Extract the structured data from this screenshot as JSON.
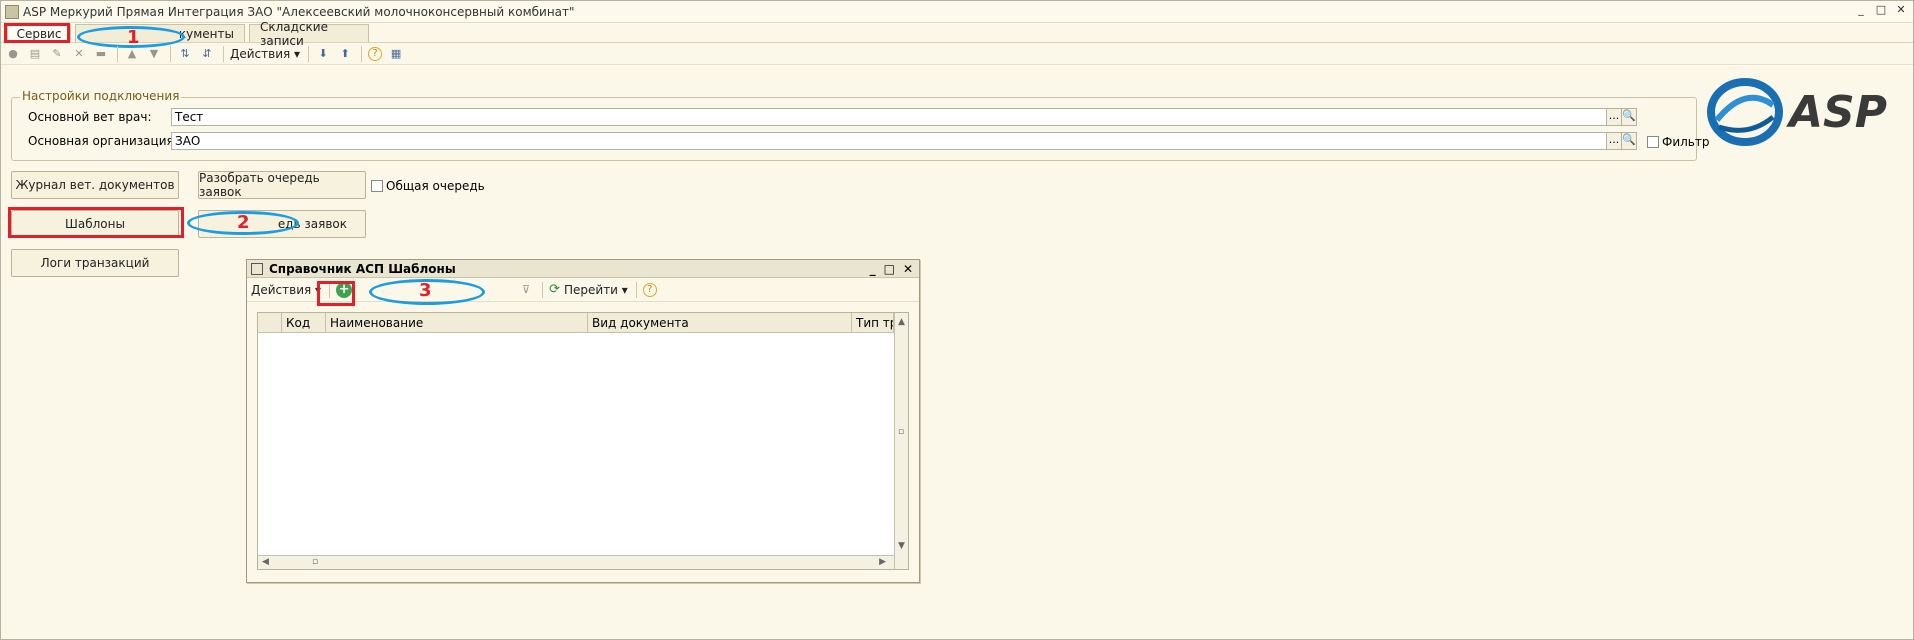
{
  "window": {
    "title": "ASP Меркурий Прямая Интеграция ЗАО \"Алексеевский молочноконсервный комбинат\"",
    "controls": [
      "_",
      "□",
      "✕"
    ]
  },
  "tabs": [
    {
      "label": "Сервис",
      "active": true
    },
    {
      "label": "кументы",
      "active": false
    },
    {
      "label": "Складские записи",
      "active": false
    }
  ],
  "toolbar": {
    "actions_label": "Действия ▾",
    "icons": [
      "add-icon",
      "copy-icon",
      "edit-icon",
      "delete-icon",
      "mark-icon",
      "up-icon",
      "down-icon",
      "sort-asc-icon",
      "sort-desc-icon",
      "import-icon",
      "export-icon",
      "help-icon",
      "settings-icon"
    ]
  },
  "settings": {
    "group_title": "Настройки подключения",
    "vet_label": "Основной вет врач:",
    "vet_value": "Тест",
    "org_label": "Основная организация:",
    "org_value": "ЗАО",
    "filter_label": "Фильтр",
    "ellipsis": "...",
    "search_glyph": "🔍"
  },
  "logo": {
    "text": "ASP",
    "colors": {
      "ring": "#1a6fb3",
      "text": "#3a3a3a"
    }
  },
  "buttons": {
    "journal": "Журнал вет. документов",
    "parse_queue": "Разобрать очередь заявок",
    "common_queue": "Общая очередь",
    "templates": "Шаблоны",
    "queue2": "едь заявок",
    "logs": "Логи транзакций"
  },
  "annotations": {
    "n1": "1",
    "n2": "2",
    "n3": "3",
    "red": "#e0202a",
    "blue": "#1d9ce0"
  },
  "child_window": {
    "title": "Справочник АСП Шаблоны",
    "controls": [
      "_",
      "□",
      "✕"
    ],
    "actions_label": "Действия ▾",
    "goto_label": "Перейти ▾",
    "help": "?",
    "columns": [
      "",
      "Код",
      "Наименование",
      "Вид документа",
      "Тип тра"
    ]
  }
}
